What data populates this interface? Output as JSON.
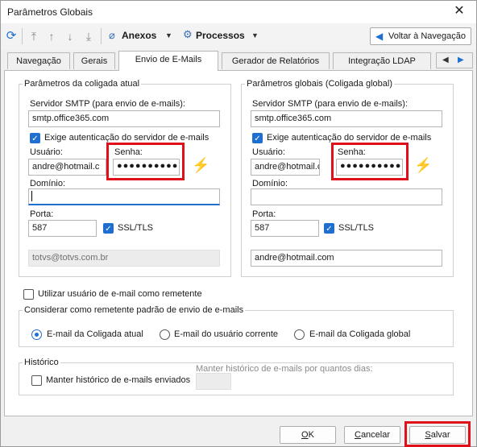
{
  "window": {
    "title": "Parâmetros Globais"
  },
  "toolbar": {
    "anexos_label": "Anexos",
    "processos_label": "Processos",
    "back_label": "Voltar à Navegação"
  },
  "tabs": [
    {
      "label": "Navegação"
    },
    {
      "label": "Gerais"
    },
    {
      "label": "Envio de E-Mails"
    },
    {
      "label": "Gerador de Relatórios"
    },
    {
      "label": "Integração LDAP"
    }
  ],
  "coligada_atual": {
    "legend": "Parâmetros da coligada atual",
    "smtp_label": "Servidor SMTP (para envio de e-mails):",
    "smtp_value": "smtp.office365.com",
    "auth_label": "Exige autenticação do servidor de e-mails",
    "auth_checked": true,
    "usuario_label": "Usuário:",
    "usuario_value": "andre@hotmail.c",
    "senha_label": "Senha:",
    "senha_value": "●●●●●●●●●●●",
    "dominio_label": "Domínio:",
    "dominio_value": "",
    "porta_label": "Porta:",
    "porta_value": "587",
    "ssl_label": "SSL/TLS",
    "ssl_checked": true,
    "email_value": "totvs@totvs.com.br"
  },
  "coligada_global": {
    "legend": "Parâmetros globais (Coligada global)",
    "smtp_label": "Servidor SMTP (para envio de e-mails):",
    "smtp_value": "smtp.office365.com",
    "auth_label": "Exige autenticação do servidor de e-mails",
    "auth_checked": true,
    "usuario_label": "Usuário:",
    "usuario_value": "andre@hotmail.c",
    "senha_label": "Senha:",
    "senha_value": "●●●●●●●●●●●",
    "dominio_label": "Domínio:",
    "dominio_value": "",
    "porta_label": "Porta:",
    "porta_value": "587",
    "ssl_label": "SSL/TLS",
    "ssl_checked": true,
    "email_value": "andre@hotmail.com"
  },
  "use_user_email": {
    "label": "Utilizar usuário de e-mail como remetente",
    "checked": false
  },
  "remetente": {
    "legend": "Considerar como remetente padrão de envio de e-mails",
    "options": [
      {
        "label": "E-mail da Coligada atual",
        "selected": true
      },
      {
        "label": "E-mail do usuário corrente",
        "selected": false
      },
      {
        "label": "E-mail da Coligada global",
        "selected": false
      }
    ]
  },
  "historico": {
    "legend": "Histórico",
    "keep_label": "Manter histórico de e-mails enviados",
    "keep_checked": false,
    "days_label": "Manter histórico de e-mails por quantos dias:",
    "days_value": ""
  },
  "buttons": {
    "ok": {
      "underlined": "O",
      "rest": "K"
    },
    "cancel": {
      "underlined": "C",
      "rest": "ancelar"
    },
    "save": {
      "underlined": "S",
      "rest": "alvar"
    }
  },
  "colors": {
    "accent": "#1e6fd0",
    "highlight": "#e0101a",
    "bolt": "#f4a51a"
  }
}
